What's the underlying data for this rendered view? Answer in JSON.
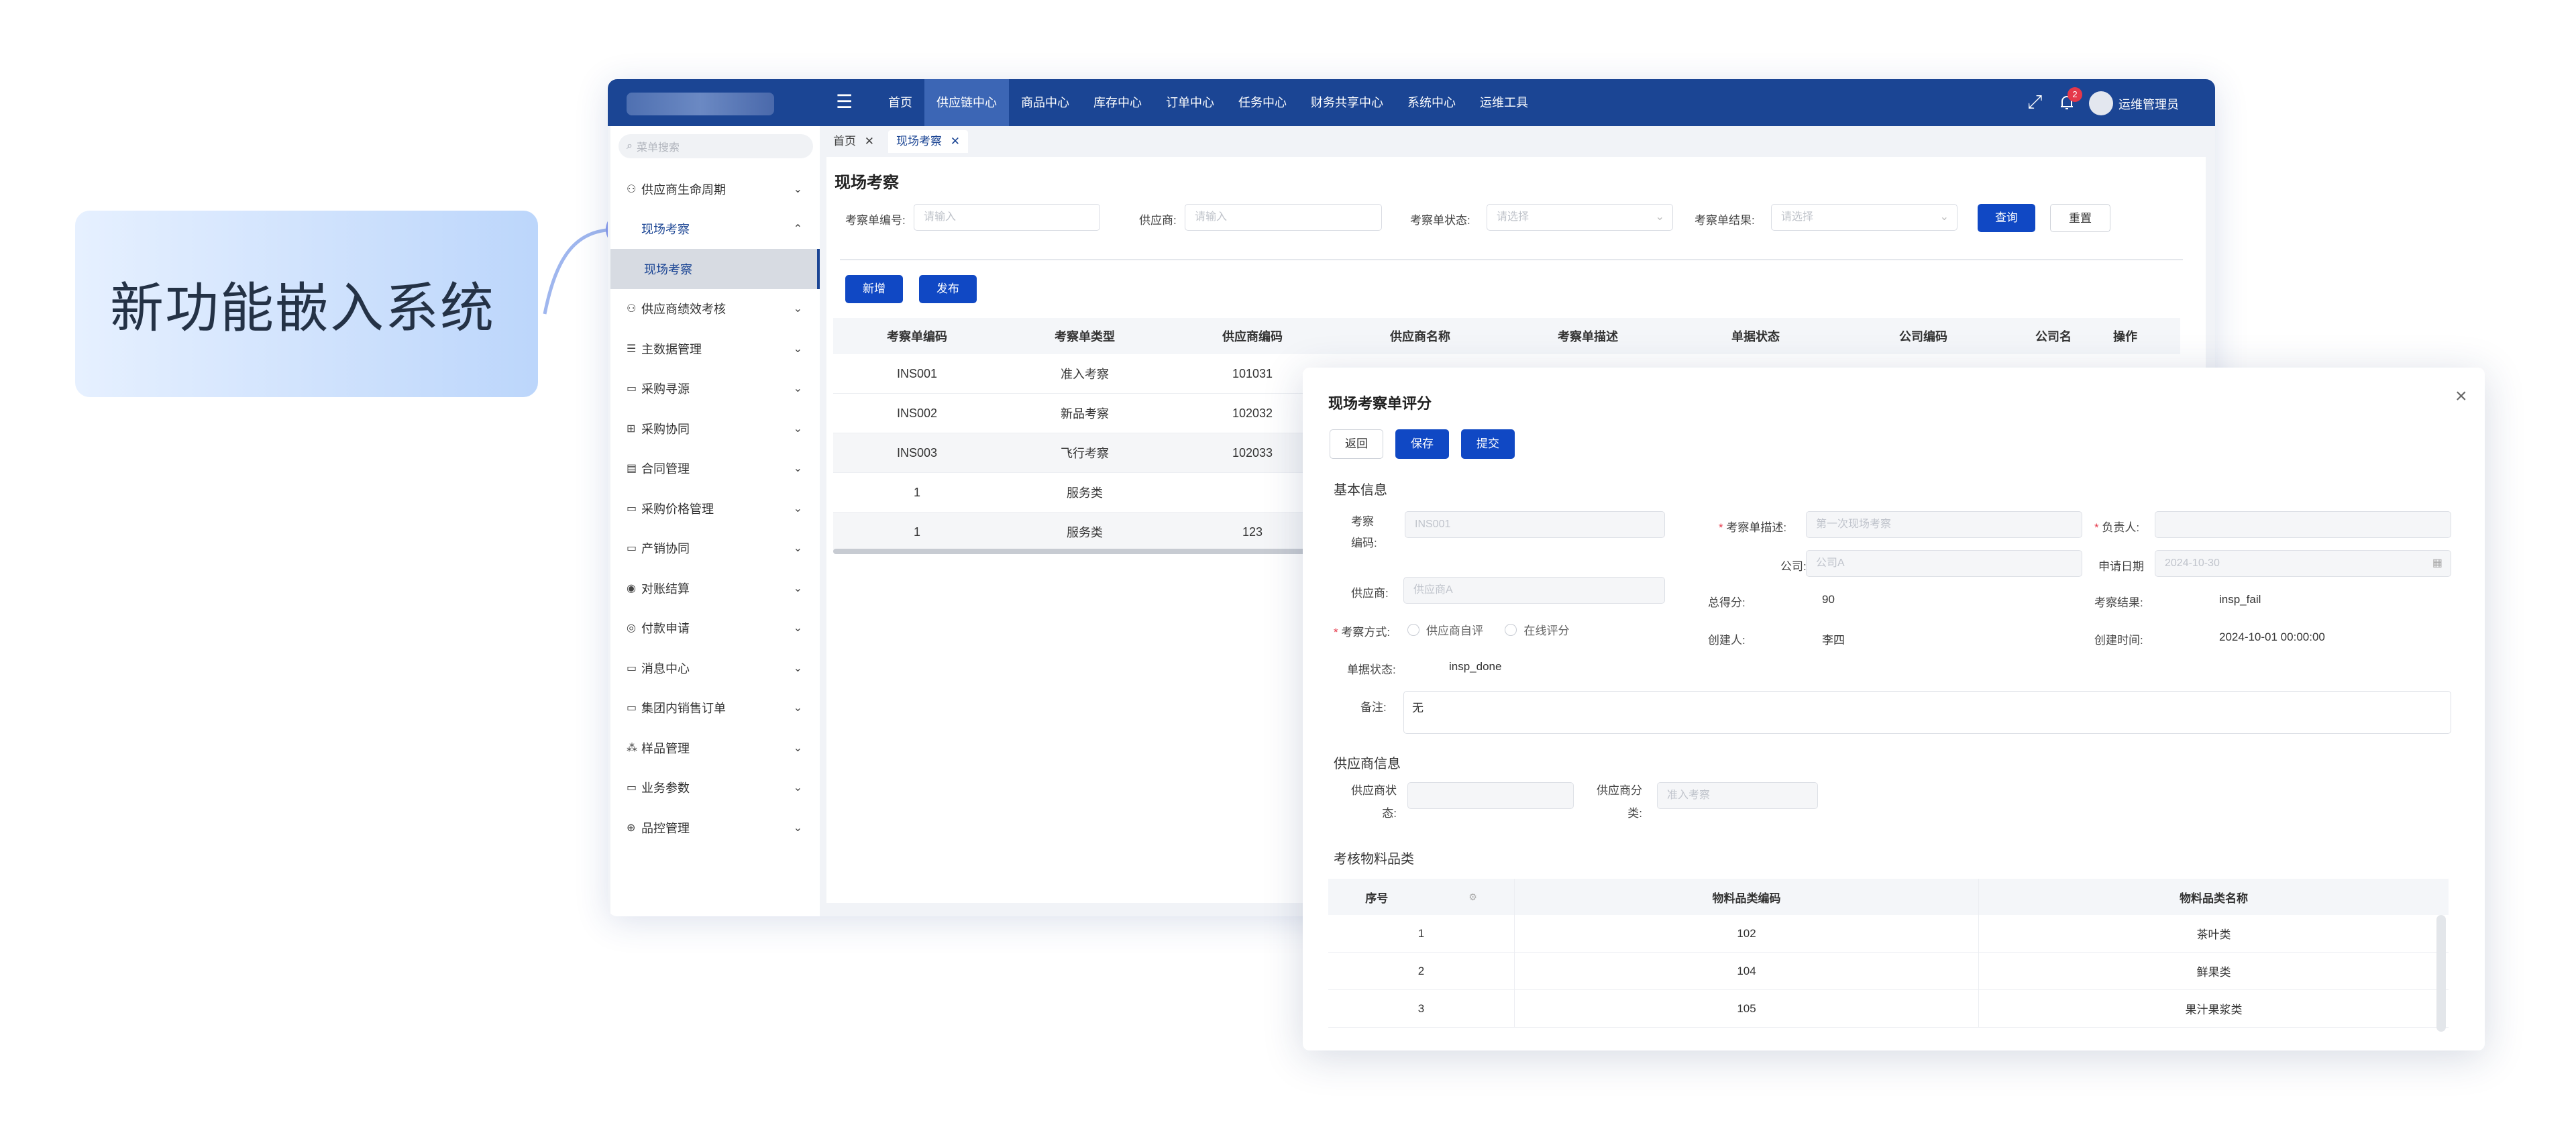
{
  "callout": {
    "text": "新功能嵌入系统"
  },
  "topbar": {
    "nav": [
      "首页",
      "供应链中心",
      "商品中心",
      "库存中心",
      "订单中心",
      "任务中心",
      "财务共享中心",
      "系统中心",
      "运维工具"
    ],
    "notification_count": "2",
    "user": "运维管理员"
  },
  "sidebar": {
    "search_placeholder": "菜单搜索",
    "items": [
      {
        "label": "供应商生命周期",
        "icon": "people-icon"
      },
      {
        "label": "现场考察",
        "icon": "none"
      },
      {
        "label": "现场考察",
        "icon": "none"
      },
      {
        "label": "供应商绩效考核",
        "icon": "people-icon"
      },
      {
        "label": "主数据管理",
        "icon": "list-icon"
      },
      {
        "label": "采购寻源",
        "icon": "calendar-icon"
      },
      {
        "label": "采购协同",
        "icon": "grid-icon"
      },
      {
        "label": "合同管理",
        "icon": "document-icon"
      },
      {
        "label": "采购价格管理",
        "icon": "folder-icon"
      },
      {
        "label": "产销协同",
        "icon": "folder-icon"
      },
      {
        "label": "对账结算",
        "icon": "target-icon"
      },
      {
        "label": "付款申请",
        "icon": "target-icon"
      },
      {
        "label": "消息中心",
        "icon": "folder-icon"
      },
      {
        "label": "集团内销售订单",
        "icon": "folder-icon"
      },
      {
        "label": "样品管理",
        "icon": "nodes-icon"
      },
      {
        "label": "业务参数",
        "icon": "folder-icon"
      },
      {
        "label": "品控管理",
        "icon": "search-icon"
      }
    ]
  },
  "tabs": [
    "首页",
    "现场考察"
  ],
  "page": {
    "title": "现场考察",
    "filters": [
      {
        "label": "考察单编号:",
        "placeholder": "请输入"
      },
      {
        "label": "供应商:",
        "placeholder": "请输入"
      },
      {
        "label": "考察单状态:",
        "placeholder": "请选择"
      },
      {
        "label": "考察单结果:",
        "placeholder": "请选择"
      }
    ],
    "query": "查询",
    "reset": "重置",
    "add": "新增",
    "publish": "发布",
    "table": {
      "columns": [
        "考察单编码",
        "考察单类型",
        "供应商编码",
        "供应商名称",
        "考察单描述",
        "单据状态",
        "公司编码",
        "公司名",
        "操作"
      ],
      "rows": [
        [
          "INS001",
          "准入考察",
          "101031"
        ],
        [
          "INS002",
          "新品考察",
          "102032"
        ],
        [
          "INS003",
          "飞行考察",
          "102033"
        ],
        [
          "1",
          "服务类",
          ""
        ],
        [
          "1",
          "服务类",
          "123"
        ]
      ]
    }
  },
  "modal": {
    "title": "现场考察单评分",
    "buttons": {
      "back": "返回",
      "save": "保存",
      "submit": "提交"
    },
    "basic_title": "基本信息",
    "fields": {
      "code_label": "考察编码:",
      "code_value": "INS001",
      "desc_label": "考察单描述:",
      "desc_value": "第一次现场考察",
      "owner_label": "负责人:",
      "company_label": "公司:",
      "company_value": "公司A",
      "apply_date_label": "申请日期",
      "apply_date_value": "2024-10-30",
      "supplier_label": "供应商:",
      "supplier_value": "供应商A",
      "score_label": "总得分:",
      "score_value": "90",
      "result_label": "考察结果:",
      "result_value": "insp_fail",
      "method_label": "考察方式:",
      "method_opt1": "供应商自评",
      "method_opt2": "在线评分",
      "creator_label": "创建人:",
      "creator_value": "李四",
      "created_label": "创建时间:",
      "created_value": "2024-10-01 00:00:00",
      "status_label": "单据状态:",
      "status_value": "insp_done",
      "remark_label": "备注:",
      "remark_value": "无"
    },
    "supplier_title": "供应商信息",
    "supplier_fields": {
      "state_label": "供应商状态:",
      "cat_label": "供应商分类:",
      "cat_placeholder": "准入考察"
    },
    "category_title": "考核物料品类",
    "category_table": {
      "columns": [
        "序号",
        "物料品类编码",
        "物料品类名称"
      ],
      "rows": [
        [
          "1",
          "102",
          "茶叶类"
        ],
        [
          "2",
          "104",
          "鲜果类"
        ],
        [
          "3",
          "105",
          "果汁果浆类"
        ]
      ]
    }
  },
  "colors": {
    "primary": "#1048c4",
    "topbar": "#1b4594",
    "active_nav": "#3c66b5"
  }
}
